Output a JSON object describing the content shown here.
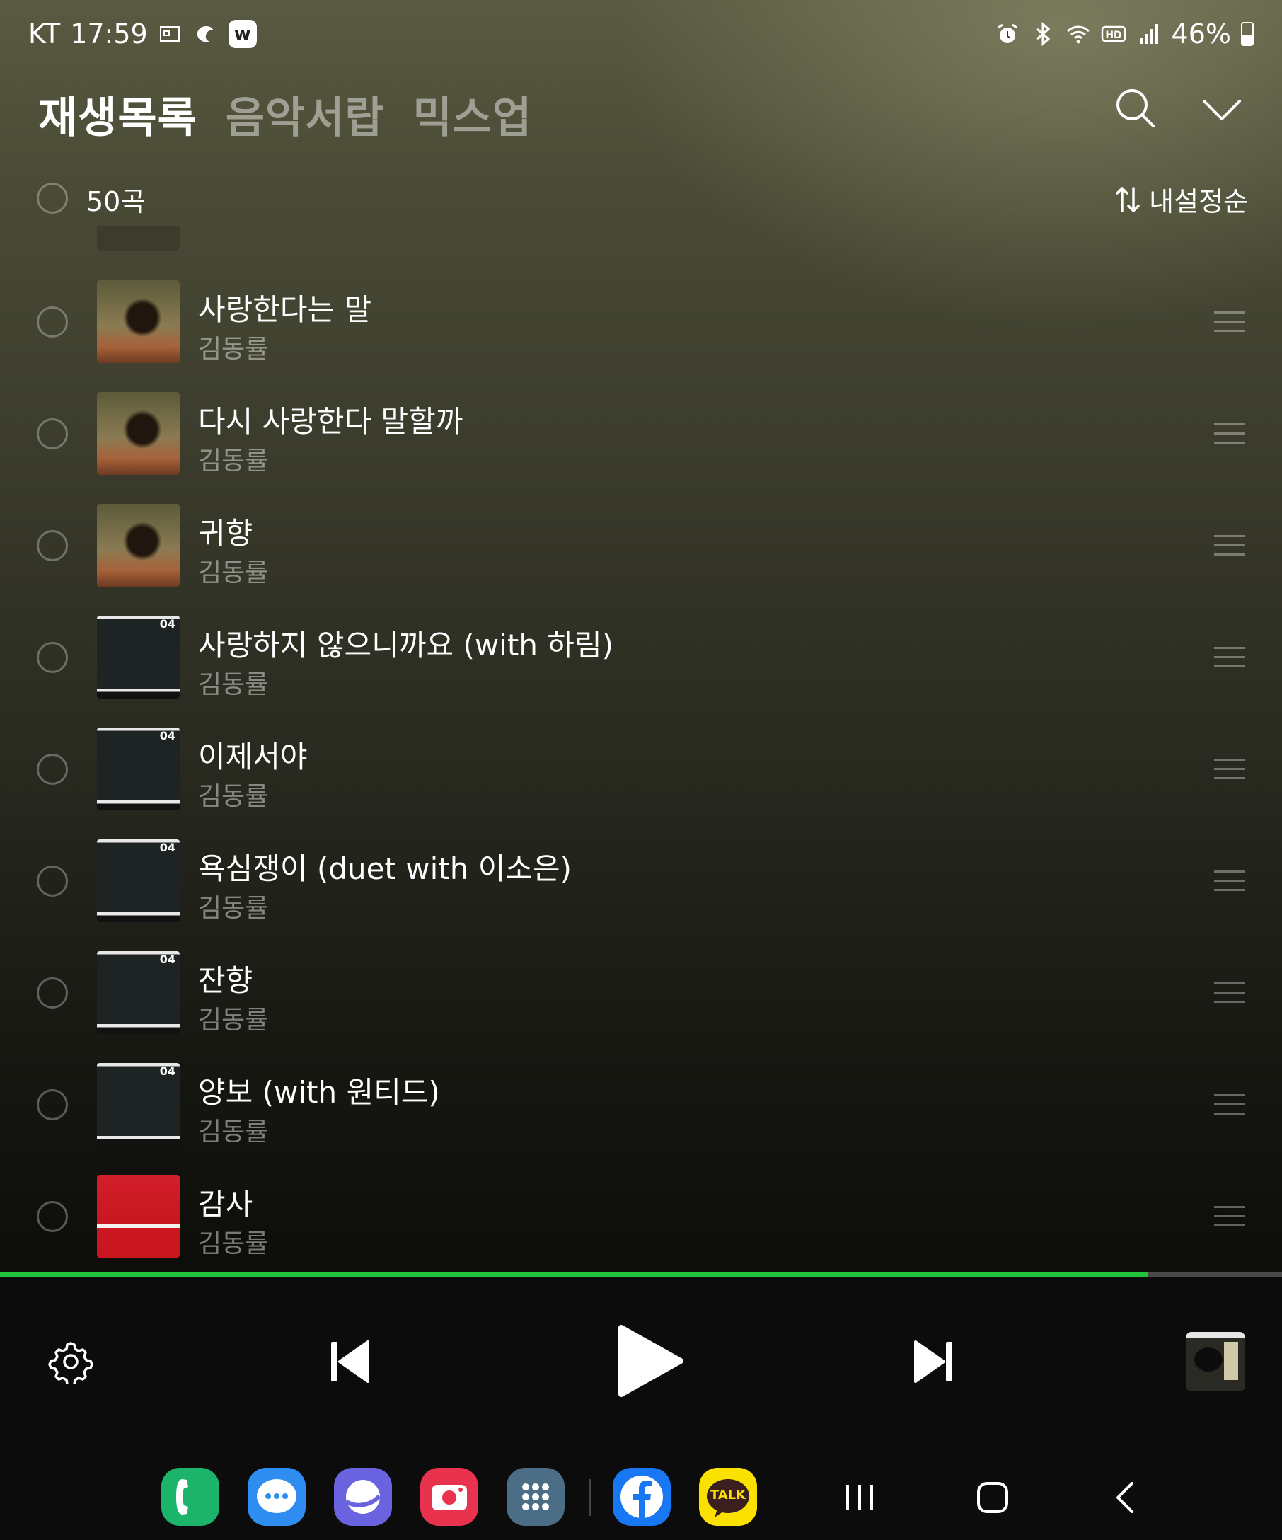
{
  "status_bar": {
    "carrier": "KT",
    "time": "17:59",
    "battery": "46%",
    "battery_level": 0.46
  },
  "tabs": [
    {
      "label": "재생목록",
      "active": true
    },
    {
      "label": "음악서랍",
      "active": false
    },
    {
      "label": "믹스업",
      "active": false
    }
  ],
  "header_icons": [
    "search-icon",
    "chevron-down-icon"
  ],
  "list": {
    "count": "50곡",
    "sort_label": "내설정순"
  },
  "tracks": [
    {
      "title": "사랑한다는 말",
      "artist": "김동률",
      "art": "a"
    },
    {
      "title": "다시 사랑한다 말할까",
      "artist": "김동률",
      "art": "a"
    },
    {
      "title": "귀향",
      "artist": "김동률",
      "art": "a"
    },
    {
      "title": "사랑하지 않으니까요 (with 하림)",
      "artist": "김동률",
      "art": "b"
    },
    {
      "title": "이제서야",
      "artist": "김동률",
      "art": "b"
    },
    {
      "title": "욕심쟁이 (duet with 이소은)",
      "artist": "김동률",
      "art": "b"
    },
    {
      "title": "잔향",
      "artist": "김동률",
      "art": "b"
    },
    {
      "title": "양보 (with 원티드)",
      "artist": "김동률",
      "art": "b"
    },
    {
      "title": "감사",
      "artist": "김동률",
      "art": "c"
    }
  ],
  "album_art_label": "04",
  "playback": {
    "progress": 0.895,
    "accent_color": "#22c43a"
  },
  "dock_apps": [
    {
      "name": "phone",
      "color": "#1bb46a"
    },
    {
      "name": "messages",
      "color": "#2f8cf0"
    },
    {
      "name": "internet",
      "color": "#6a63e0"
    },
    {
      "name": "camera",
      "color": "#e8324e"
    },
    {
      "name": "apps",
      "color": "#4b6d86"
    },
    {
      "name": "facebook",
      "color": "#1877f2"
    },
    {
      "name": "kakaotalk",
      "color": "#fae100",
      "label": "TALK"
    }
  ]
}
